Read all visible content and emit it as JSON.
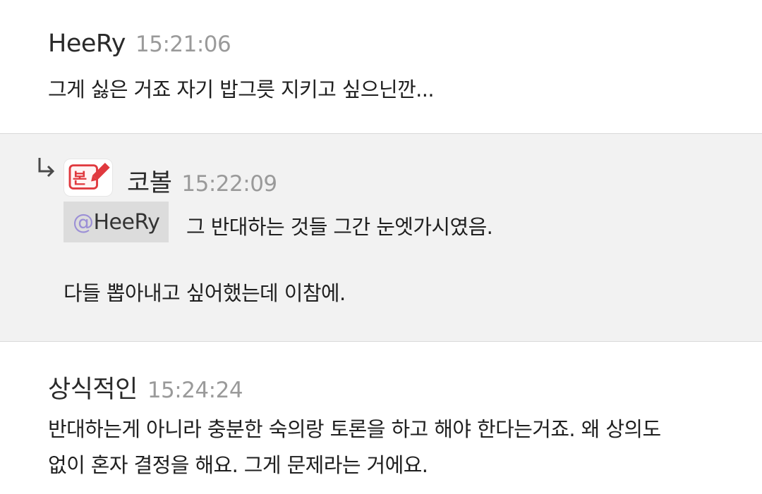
{
  "messages": [
    {
      "author": "HeeRy",
      "time": "15:21:06",
      "lines": [
        "그게 싫은 거죠 자기 밥그릇 지키고 싶으닌깐..."
      ]
    },
    {
      "author": "코볼",
      "time": "15:22:09",
      "is_reply": true,
      "avatar_text": "본",
      "mention": {
        "at": "@",
        "name": "HeeRy"
      },
      "lines": [
        "그 반대하는 것들 그간 눈엣가시였음.",
        "다들 뽑아내고 싶어했는데 이참에."
      ]
    },
    {
      "author": "상식적인",
      "time": "15:24:24",
      "lines": [
        "반대하는게 아니라 충분한 숙의랑 토론을 하고 해야 한다는거죠. 왜 상의도",
        "없이 혼자 결정을 해요. 그게 문제라는 거에요."
      ]
    }
  ],
  "colors": {
    "highlight_bg": "#f2f2f2",
    "mention_bg": "#dcdcdc",
    "mention_at": "#9b8fd6",
    "timestamp": "#9a9a9a",
    "avatar_red": "#e0393e"
  },
  "icons": {
    "reply": "reply-arrow-icon",
    "avatar": "pencil-badge-avatar"
  }
}
